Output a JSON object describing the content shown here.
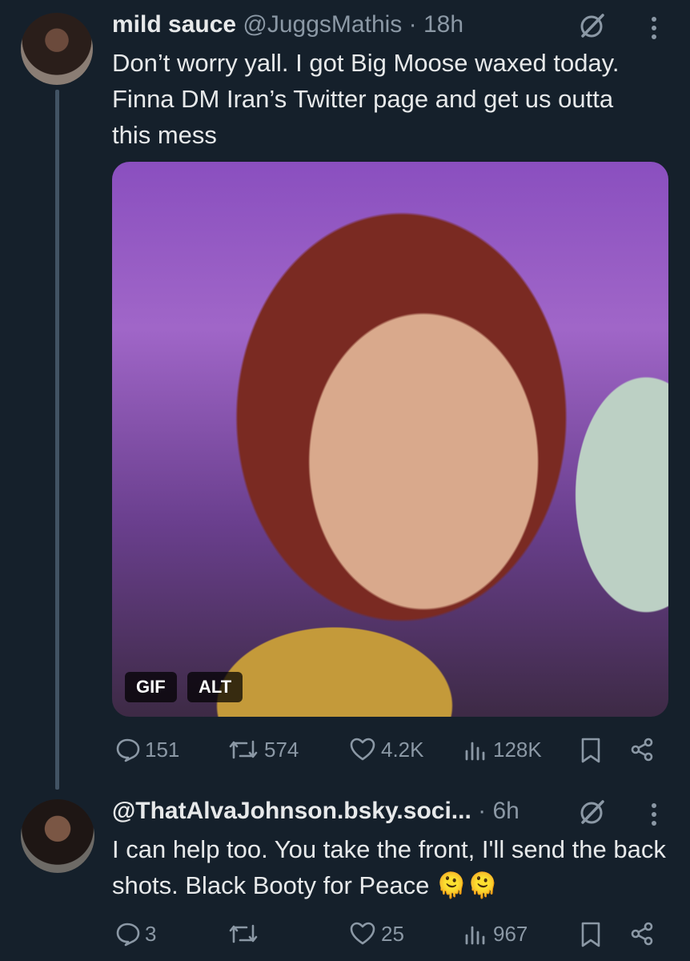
{
  "tweet": {
    "name": "mild sauce",
    "handle": "@JuggsMathis",
    "time": "· 18h",
    "text": "Don’t worry yall. I got Big Moose waxed today. Finna DM Iran’s Twitter page and get us outta this mess",
    "media": {
      "badge_gif": "GIF",
      "badge_alt": "ALT"
    },
    "stats": {
      "replies": "151",
      "reposts": "574",
      "likes": "4.2K",
      "views": "128K"
    }
  },
  "reply": {
    "name": "@ThatAlvaJohnson.bsky.soci...",
    "time": "· 6h",
    "text": "I can help too. You take the front, I'll send the back shots. Black Booty for Peace 🫠🫠",
    "stats": {
      "replies": "3",
      "reposts": "",
      "likes": "25",
      "views": "967"
    }
  },
  "icons": [
    "grok-icon",
    "more-icon",
    "reply-icon",
    "repost-icon",
    "like-icon",
    "views-icon",
    "bookmark-icon",
    "share-icon"
  ],
  "colors": {
    "background": "#15202b",
    "text": "#e7e9ea",
    "muted": "#8b98a5",
    "thread_line": "#425364"
  }
}
